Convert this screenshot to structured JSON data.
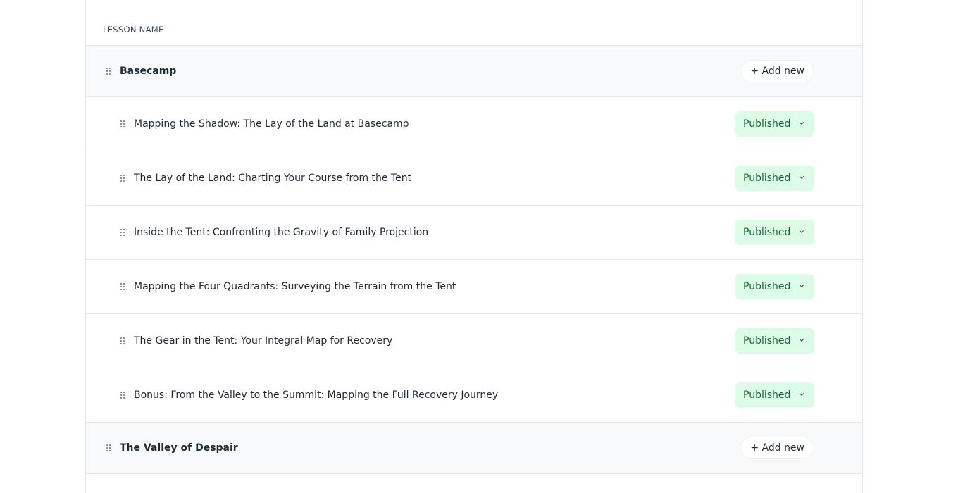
{
  "table": {
    "column_header": "LESSON NAME"
  },
  "sections": [
    {
      "title": "Basecamp",
      "add_label": "+ Add new",
      "lessons": [
        {
          "title": "Mapping the Shadow: The Lay of the Land at Basecamp",
          "status": "Published"
        },
        {
          "title": "The Lay of the Land: Charting Your Course from the Tent",
          "status": "Published"
        },
        {
          "title": "Inside the Tent: Confronting the Gravity of Family Projection",
          "status": "Published"
        },
        {
          "title": "Mapping the Four Quadrants: Surveying the Terrain from the Tent",
          "status": "Published"
        },
        {
          "title": "The Gear in the Tent: Your Integral Map for Recovery",
          "status": "Published"
        },
        {
          "title": "Bonus: From the Valley to the Summit: Mapping the Full Recovery Journey",
          "status": "Published"
        }
      ]
    },
    {
      "title": "The Valley of Despair",
      "add_label": "+ Add new",
      "lessons": []
    }
  ],
  "icons": {
    "drag": "drag-handle-icon",
    "chevron": "chevron-down-icon"
  },
  "colors": {
    "published_bg": "#dcfce7",
    "published_text": "#166534",
    "section_bg": "#f8f9fb",
    "border": "#e5e7eb"
  }
}
